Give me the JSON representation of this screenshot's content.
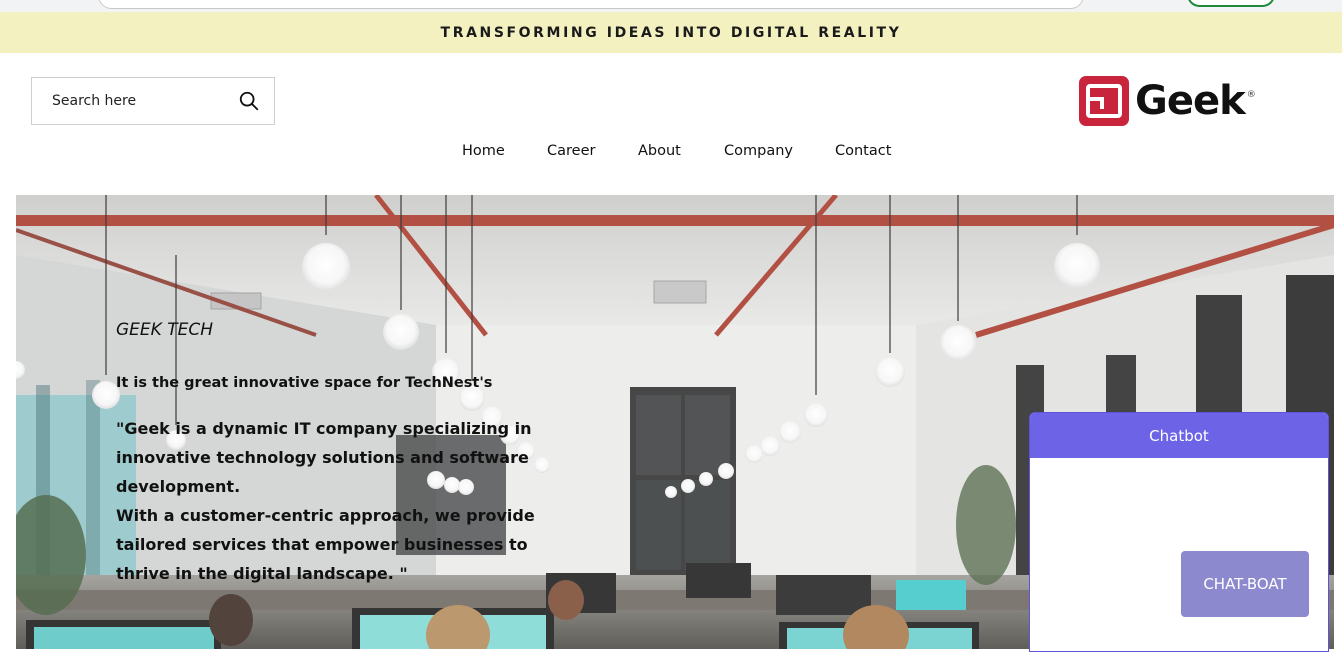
{
  "banner": {
    "text": "TRANSFORMING IDEAS INTO DIGITAL REALITY"
  },
  "search": {
    "placeholder": "Search here",
    "icon": "search-icon"
  },
  "logo": {
    "name": "Geek",
    "reg": "®",
    "icon": "geek-logo-icon",
    "color": "#c8243c"
  },
  "nav": [
    {
      "label": "Home"
    },
    {
      "label": "Career"
    },
    {
      "label": "About"
    },
    {
      "label": "Company"
    },
    {
      "label": "Contact"
    }
  ],
  "hero": {
    "title": "GEEK TECH",
    "tagline": "It is the great innovative space for TechNest's",
    "description_line1": "\"Geek is a dynamic IT company specializing in innovative technology solutions and software development.",
    "description_line2": "With a customer-centric approach, we provide tailored services that empower businesses to thrive in the digital landscape. \""
  },
  "chatbot": {
    "title": "Chatbot",
    "button_label": "CHAT-BOAT",
    "header_color": "#6c63e6",
    "button_color": "#8c89cf"
  },
  "colors": {
    "banner_bg": "#f4f1c1",
    "accent": "#6c63e6"
  }
}
